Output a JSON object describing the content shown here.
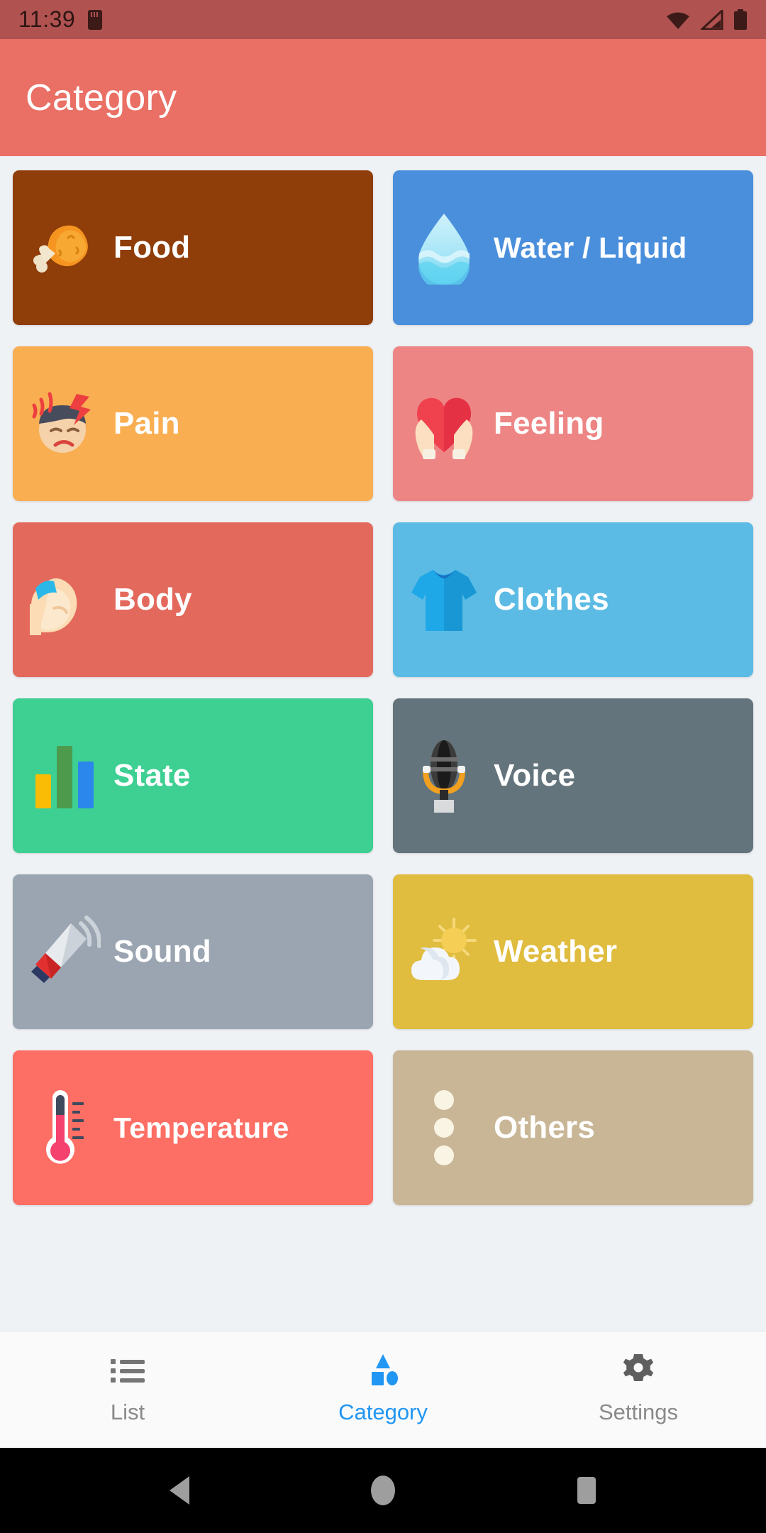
{
  "status_bar": {
    "time": "11:39",
    "icons": [
      "sd-card-icon",
      "wifi-icon",
      "cellular-signal-icon",
      "battery-icon"
    ]
  },
  "app_bar": {
    "title": "Category"
  },
  "categories": [
    {
      "label": "Food",
      "icon": "fried-chicken-icon",
      "color": "#8F3D09",
      "text_color": "#FFFFFF"
    },
    {
      "label": "Water / Liquid",
      "icon": "water-drop-icon",
      "color": "#4A8FDC",
      "text_color": "#FFFFFF"
    },
    {
      "label": "Pain",
      "icon": "headache-face-icon",
      "color": "#F9AE52",
      "text_color": "#FFFFFF"
    },
    {
      "label": "Feeling",
      "icon": "heart-in-hands-icon",
      "color": "#EE8585",
      "text_color": "#FFFFFF"
    },
    {
      "label": "Body",
      "icon": "flexed-bicep-icon",
      "color": "#E3695C",
      "text_color": "#FFFFFF"
    },
    {
      "label": "Clothes",
      "icon": "t-shirt-icon",
      "color": "#5BBBE4",
      "text_color": "#FFFFFF"
    },
    {
      "label": "State",
      "icon": "bar-chart-icon",
      "color": "#3ECF92",
      "text_color": "#FFFFFF"
    },
    {
      "label": "Voice",
      "icon": "microphone-icon",
      "color": "#63747C",
      "text_color": "#FFFFFF"
    },
    {
      "label": "Sound",
      "icon": "megaphone-icon",
      "color": "#9AA5B1",
      "text_color": "#FFFFFF"
    },
    {
      "label": "Weather",
      "icon": "sun-behind-cloud-icon",
      "color": "#E0BC3F",
      "text_color": "#FFFFFF"
    },
    {
      "label": "Temperature",
      "icon": "thermometer-icon",
      "color": "#FD6E64",
      "text_color": "#FFFFFF"
    },
    {
      "label": "Others",
      "icon": "three-dots-icon",
      "color": "#C8B696",
      "text_color": "#FFFFFF"
    }
  ],
  "bottom_nav": {
    "active_color": "#2196F3",
    "inactive_color": "#8A8A8A",
    "items": [
      {
        "label": "List",
        "icon": "list-icon",
        "active": false
      },
      {
        "label": "Category",
        "icon": "shapes-icon",
        "active": true
      },
      {
        "label": "Settings",
        "icon": "gear-icon",
        "active": false
      }
    ]
  },
  "system_nav": {
    "buttons": [
      {
        "name": "back-button",
        "icon": "triangle-back-icon"
      },
      {
        "name": "home-button",
        "icon": "circle-home-icon"
      },
      {
        "name": "recents-button",
        "icon": "square-recents-icon"
      }
    ]
  }
}
